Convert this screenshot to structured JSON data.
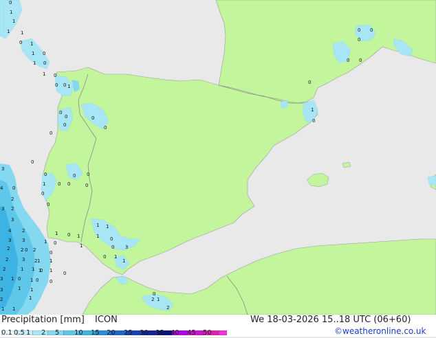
{
  "title": "Precipitation [mm]",
  "model": "ICON",
  "valid_time": "We 18-03-2026 15..18 UTC (06+60)",
  "credit": "©weatheronline.co.uk",
  "colors": {
    "sea": "#e9e9e9",
    "land": "#c2f59c",
    "border": "#8a8a8a"
  },
  "legend": {
    "labels": [
      "0.1",
      "0.5",
      "1",
      "2",
      "5",
      "10",
      "15",
      "20",
      "25",
      "30",
      "35",
      "40",
      "45",
      "50"
    ],
    "colors": [
      "#e8fbff",
      "#c8f0fa",
      "#a8e6f6",
      "#84d8f0",
      "#5fc8ea",
      "#3cb3e2",
      "#2a8fd8",
      "#1f66c9",
      "#1841b8",
      "#12239c",
      "#0a0f7a",
      "#b000e0",
      "#d012d0",
      "#e020b0",
      "#f030d8"
    ]
  },
  "cells": [
    {
      "v": "1"
    },
    {
      "v": "1"
    },
    {
      "v": "1"
    },
    {
      "v": "0"
    },
    {
      "v": "1"
    },
    {
      "v": "0"
    },
    {
      "v": "1"
    },
    {
      "v": "0"
    },
    {
      "v": "1"
    },
    {
      "v": "1"
    },
    {
      "v": "0"
    },
    {
      "v": "1"
    },
    {
      "v": "0"
    },
    {
      "v": "1"
    },
    {
      "v": "0"
    },
    {
      "v": "0"
    },
    {
      "v": "0"
    },
    {
      "v": "0"
    },
    {
      "v": "0"
    },
    {
      "v": "0"
    },
    {
      "v": "0"
    },
    {
      "v": "0"
    },
    {
      "v": "0"
    },
    {
      "v": "0"
    },
    {
      "v": "0"
    },
    {
      "v": "0"
    },
    {
      "v": "1"
    },
    {
      "v": "0"
    },
    {
      "v": "0"
    },
    {
      "v": "0"
    },
    {
      "v": "0"
    },
    {
      "v": "0"
    },
    {
      "v": "0"
    },
    {
      "v": "1"
    },
    {
      "v": "0"
    },
    {
      "v": "0"
    },
    {
      "v": "0"
    },
    {
      "v": "0"
    },
    {
      "v": "0"
    },
    {
      "v": "0"
    },
    {
      "v": "3"
    },
    {
      "v": "4"
    },
    {
      "v": "2"
    },
    {
      "v": "3"
    },
    {
      "v": "2"
    },
    {
      "v": "3"
    },
    {
      "v": "4"
    },
    {
      "v": "2"
    },
    {
      "v": "3"
    },
    {
      "v": "3"
    },
    {
      "v": "2"
    },
    {
      "v": "2"
    },
    {
      "v": "2"
    },
    {
      "v": "2"
    },
    {
      "v": "1"
    },
    {
      "v": "2"
    },
    {
      "v": "1"
    },
    {
      "v": "3"
    },
    {
      "v": "2"
    },
    {
      "v": "1"
    },
    {
      "v": "3"
    },
    {
      "v": "1"
    },
    {
      "v": "1"
    },
    {
      "v": "0"
    },
    {
      "v": "1"
    },
    {
      "v": "1"
    },
    {
      "v": "0"
    },
    {
      "v": "0"
    },
    {
      "v": "3"
    },
    {
      "v": "0"
    },
    {
      "v": "1"
    },
    {
      "v": "2"
    },
    {
      "v": "1"
    },
    {
      "v": "1"
    },
    {
      "v": "1"
    },
    {
      "v": "1"
    },
    {
      "v": "0"
    },
    {
      "v": "1"
    },
    {
      "v": "1"
    },
    {
      "v": "0"
    },
    {
      "v": "0"
    },
    {
      "v": "1"
    },
    {
      "v": "1"
    },
    {
      "v": "1"
    },
    {
      "v": "0"
    },
    {
      "v": "3"
    },
    {
      "v": "1"
    },
    {
      "v": "0"
    },
    {
      "v": "1"
    },
    {
      "v": "1"
    },
    {
      "v": "2"
    },
    {
      "v": "1"
    },
    {
      "v": "1"
    },
    {
      "v": "0"
    },
    {
      "v": "0"
    },
    {
      "v": "0"
    },
    {
      "v": "0"
    },
    {
      "v": "0"
    },
    {
      "v": "1"
    },
    {
      "v": "2"
    },
    {
      "v": "1"
    }
  ]
}
